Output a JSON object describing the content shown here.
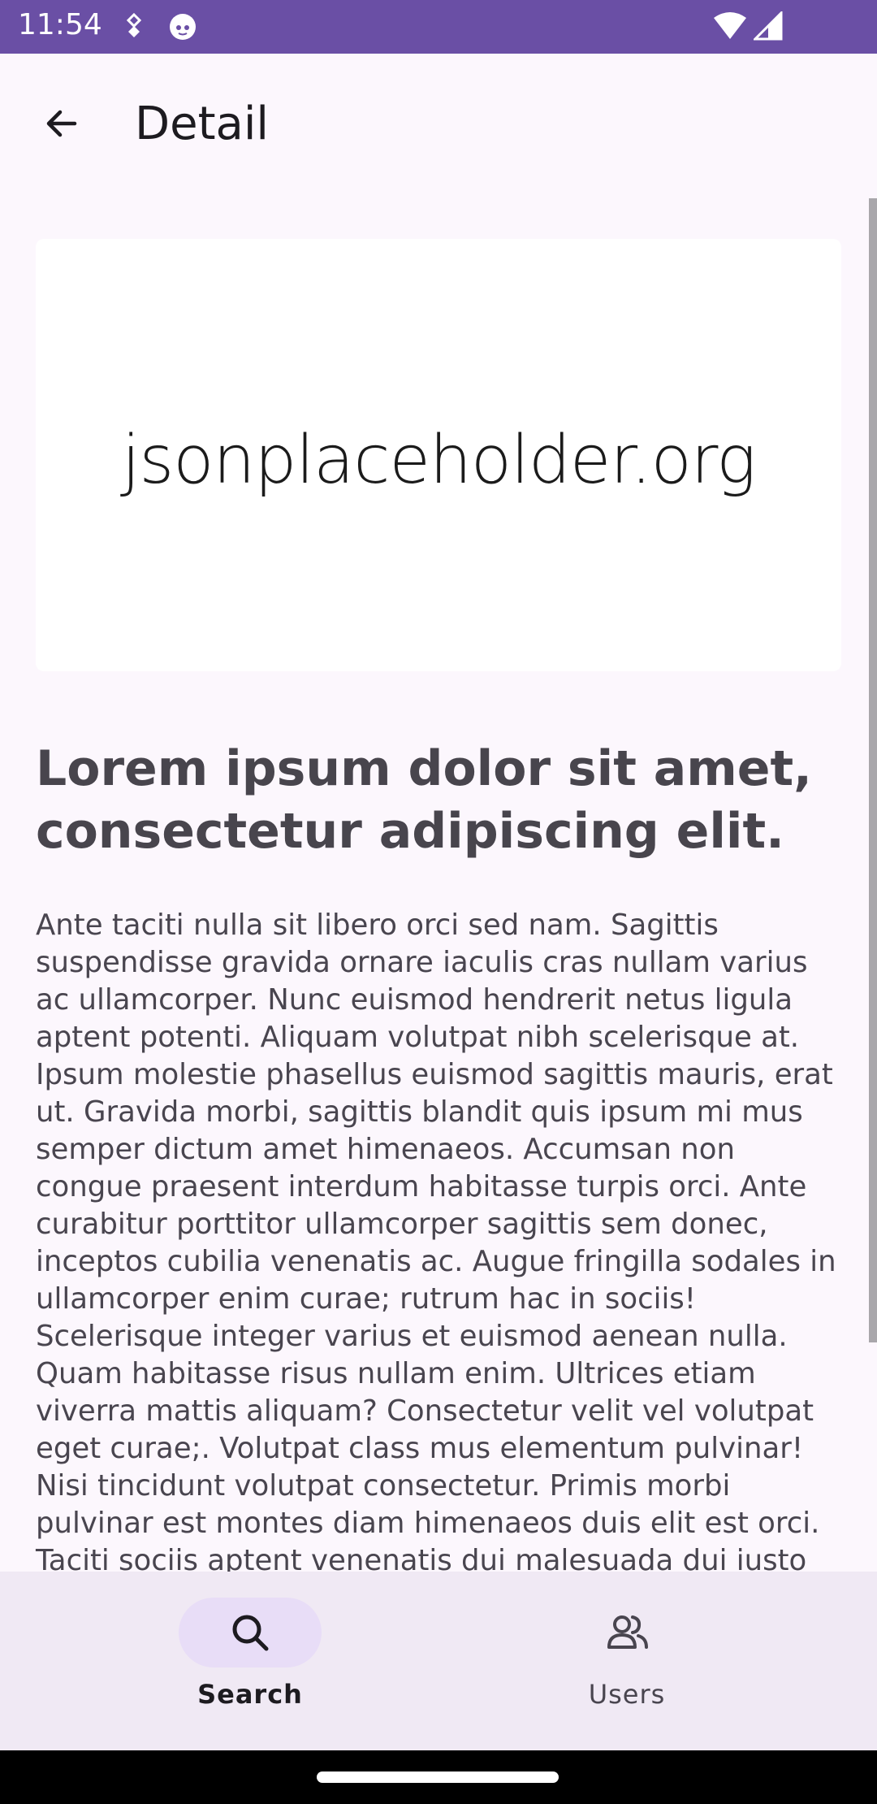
{
  "status_bar": {
    "time": "11:54",
    "icons": [
      "usb-debug-icon",
      "cat-app-icon",
      "wifi-icon",
      "signal-icon"
    ],
    "background": "#6a4fa5"
  },
  "app_bar": {
    "title": "Detail",
    "back_icon": "arrow-left-icon"
  },
  "detail": {
    "image_text": "jsonplaceholder.org",
    "headline": "Lorem ipsum dolor sit amet, consectetur adipiscing elit.",
    "body": "Ante taciti nulla sit libero orci sed nam. Sagittis suspendisse gravida ornare iaculis cras nullam varius ac ullamcorper. Nunc euismod hendrerit netus ligula aptent potenti. Aliquam volutpat nibh scelerisque at. Ipsum molestie phasellus euismod sagittis mauris, erat ut. Gravida morbi, sagittis blandit quis ipsum mi mus semper dictum amet himenaeos. Accumsan non congue praesent interdum habitasse turpis orci. Ante curabitur porttitor ullamcorper sagittis sem donec, inceptos cubilia venenatis ac. Augue fringilla sodales in ullamcorper enim curae; rutrum hac in sociis! Scelerisque integer varius et euismod aenean nulla. Quam habitasse risus nullam enim. Ultrices etiam viverra mattis aliquam? Consectetur velit vel volutpat eget curae;. Volutpat class mus elementum pulvinar! Nisi tincidunt volutpat consectetur. Primis morbi pulvinar est montes diam himenaeos duis elit est orci. Taciti sociis aptent venenatis dui malesuada dui iusto faucibus primis consequat volutpat. Rhoncus"
  },
  "bottom_nav": {
    "items": [
      {
        "label": "Search",
        "icon": "search-icon",
        "active": true
      },
      {
        "label": "Users",
        "icon": "users-icon",
        "active": false
      }
    ]
  },
  "colors": {
    "accent": "#6a4fa5",
    "nav_background": "#f0e9f4",
    "active_pill": "#e8ddf7"
  }
}
